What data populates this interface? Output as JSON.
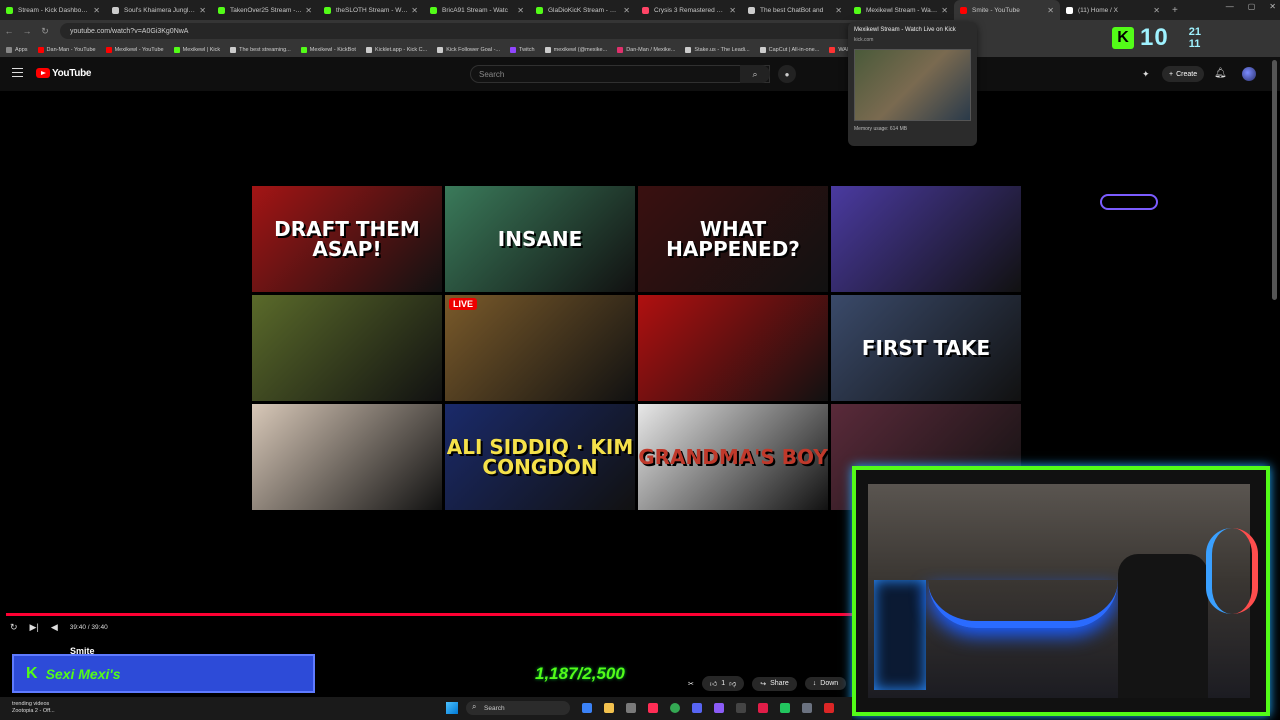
{
  "browser": {
    "tabs": [
      {
        "label": "Stream - Kick Dashboard",
        "color": "#53fc18"
      },
      {
        "label": "Soul's Khaimera Jungler -",
        "color": "#cccccc"
      },
      {
        "label": "TakenOver25 Stream - Wa",
        "color": "#53fc18"
      },
      {
        "label": "theSLOTH Stream - Watch",
        "color": "#53fc18"
      },
      {
        "label": "BricA91 Stream - Watc",
        "color": "#53fc18"
      },
      {
        "label": "GlaDioKicK Stream - Watc",
        "color": "#53fc18"
      },
      {
        "label": "Crysis 3 Remastered Post-",
        "color": "#ff4466"
      },
      {
        "label": "The best ChatBot and",
        "color": "#cccccc"
      },
      {
        "label": "Mexikewl Stream - Watch",
        "color": "#53fc18"
      },
      {
        "label": "Smite - YouTube",
        "color": "#ff0000",
        "active": true
      },
      {
        "label": "(11) Home / X",
        "color": "#ffffff"
      }
    ],
    "url": "youtube.com/watch?v=A0Gi3Kg0NwA",
    "bookmarks": [
      {
        "label": "Apps",
        "color": "#888888"
      },
      {
        "label": "Dan-Man - YouTube",
        "color": "#ff0000"
      },
      {
        "label": "Mexikewl - YouTube",
        "color": "#ff0000"
      },
      {
        "label": "Mexikewl | Kick",
        "color": "#53fc18"
      },
      {
        "label": "The best streaming...",
        "color": "#cccccc"
      },
      {
        "label": "Mexikewl - KickBot",
        "color": "#53fc18"
      },
      {
        "label": "Kicklet.app - Kick C...",
        "color": "#cccccc"
      },
      {
        "label": "Kick Follower Goal -...",
        "color": "#cccccc"
      },
      {
        "label": "Twitch",
        "color": "#9146ff"
      },
      {
        "label": "mexikewl (@mexike...",
        "color": "#cccccc"
      },
      {
        "label": "Dan-Man / Mexike...",
        "color": "#e1306c"
      },
      {
        "label": "Stake.us - The Leadi...",
        "color": "#cccccc"
      },
      {
        "label": "CapCut | All-in-one...",
        "color": "#cccccc"
      },
      {
        "label": "WARZONE META -",
        "color": "#ff3333"
      }
    ]
  },
  "tab_preview": {
    "title": "Mexikewl Stream - Watch Live on Kick",
    "domain": "kick.com",
    "memory": "Memory usage: 614 MB"
  },
  "youtube": {
    "brand": "YouTube",
    "search_placeholder": "Search",
    "create_label": "Create",
    "video_title": "Smite",
    "time": "39:40 / 39:40",
    "progress": 1.0,
    "likes": "1",
    "share_label": "Share",
    "download_label": "Down"
  },
  "thumbnails": [
    {
      "text": "DRAFT THEM ASAP!",
      "bg": "#a31515",
      "text_color": "#ffffff"
    },
    {
      "text": "INSANE",
      "bg": "#3a7a5a",
      "text_color": "#ffffff"
    },
    {
      "text": "WHAT HAPPENED?",
      "bg": "#3a1010",
      "text_color": "#ffffff"
    },
    {
      "text": "",
      "bg": "#4a3aa0"
    },
    {
      "text": "",
      "bg": "#5a6a2a"
    },
    {
      "text": "",
      "bg": "#7a5a2a",
      "live": "LIVE"
    },
    {
      "text": "",
      "bg": "#b01010"
    },
    {
      "text": "FIRST TAKE",
      "bg": "#3a4a6a",
      "text_color": "#ffffff"
    },
    {
      "text": "",
      "bg": "#d8c8b8"
    },
    {
      "text": "ALI SIDDIQ · KIM CONGDON",
      "bg": "#1a2a6a",
      "text_color": "#f5e14a"
    },
    {
      "text": "GRANDMA'S BOY",
      "bg": "#e8e8e8",
      "text_color": "#c0392b"
    },
    {
      "text": "",
      "bg": "#5a2a3a"
    }
  ],
  "kick_overlay": {
    "logo_letter": "K",
    "followers": "10",
    "stat_top": "21",
    "stat_bottom": "11",
    "goal_title": "Sexi Mexi's",
    "goal_progress": "1,187/2,500"
  },
  "taskbar": {
    "note_title": "trending videos",
    "note_sub": "Zootopia 2 - Off...",
    "search_label": "Search"
  }
}
